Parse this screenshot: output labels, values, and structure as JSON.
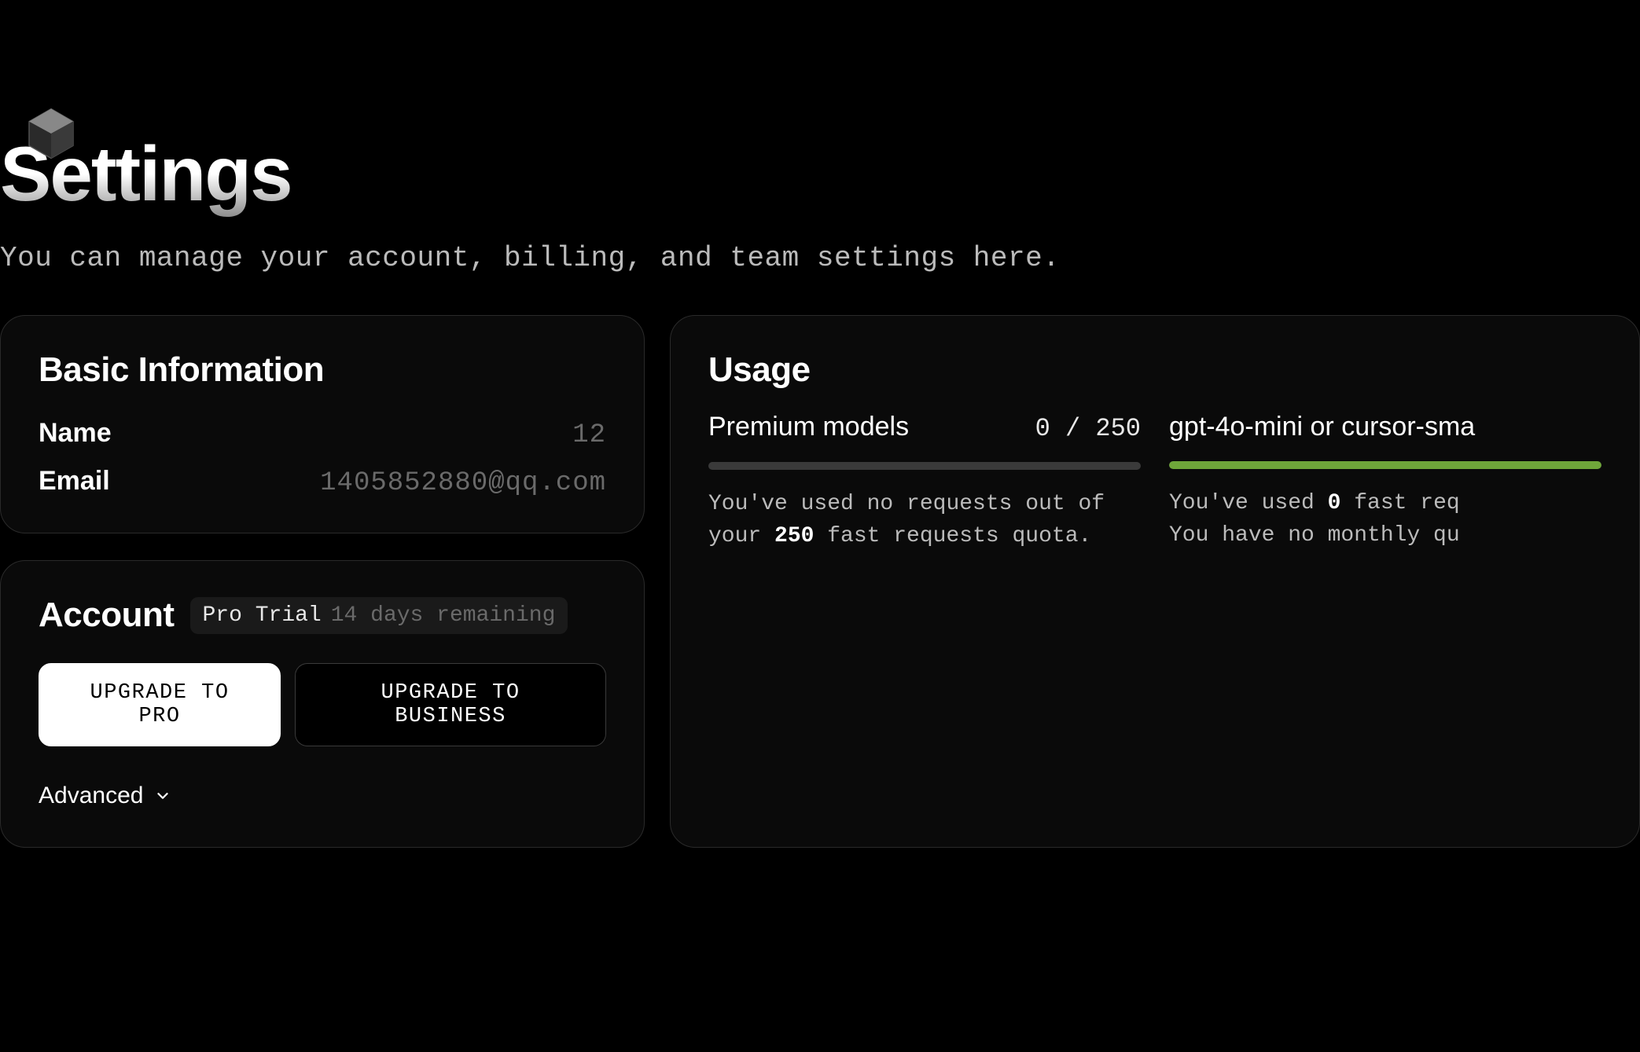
{
  "page": {
    "title": "Settings",
    "subtitle": "You can manage your account, billing, and team settings here."
  },
  "basic_info": {
    "title": "Basic Information",
    "name_label": "Name",
    "name_value": "12",
    "email_label": "Email",
    "email_value": "1405852880@qq.com"
  },
  "account": {
    "title": "Account",
    "badge_plan": "Pro Trial",
    "badge_remaining": "14 days remaining",
    "upgrade_pro_label": "UPGRADE TO PRO",
    "upgrade_business_label": "UPGRADE TO BUSINESS",
    "advanced_label": "Advanced"
  },
  "usage": {
    "title": "Usage",
    "premium": {
      "name": "Premium models",
      "count": "0 / 250",
      "desc_prefix": "You've used no requests out of your ",
      "desc_bold": "250",
      "desc_suffix": " fast requests quota."
    },
    "mini": {
      "name": "gpt-4o-mini or cursor-sma",
      "desc_line1_prefix": "You've used ",
      "desc_line1_bold": "0",
      "desc_line1_suffix": " fast req",
      "desc_line2": "You have no monthly qu"
    }
  }
}
